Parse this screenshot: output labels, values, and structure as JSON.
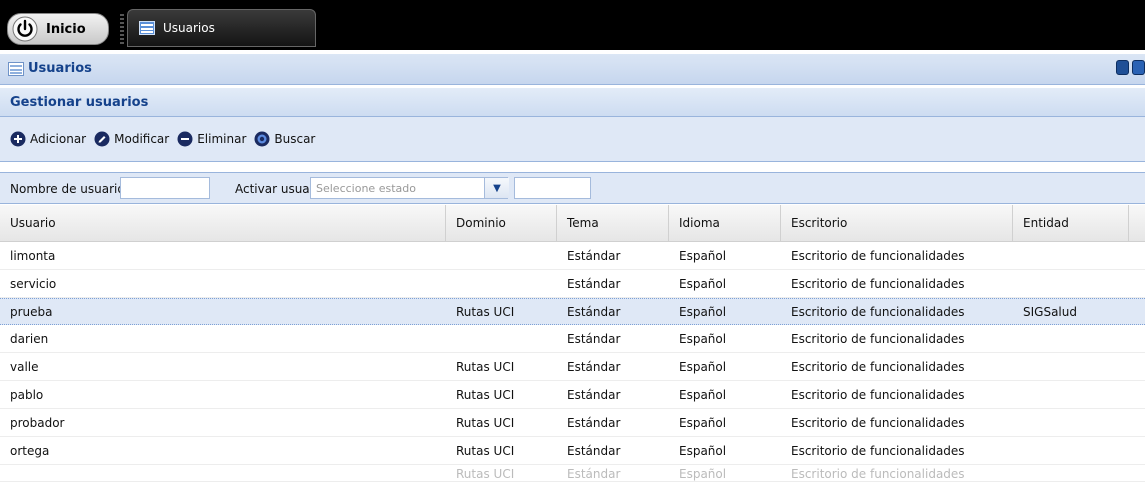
{
  "taskbar": {
    "start_label": "Inicio",
    "window_tab_label": "Usuarios"
  },
  "window": {
    "title": "Usuarios"
  },
  "panel": {
    "title": "Gestionar usuarios"
  },
  "toolbar": {
    "add_label": "Adicionar",
    "edit_label": "Modificar",
    "delete_label": "Eliminar",
    "search_label": "Buscar"
  },
  "filter": {
    "username_label": "Nombre de usuario",
    "username_value": "",
    "activate_label": "Activar usuario",
    "status_placeholder": "Seleccione estado",
    "extra_value": ""
  },
  "grid": {
    "columns": [
      "Usuario",
      "Dominio",
      "Tema",
      "Idioma",
      "Escritorio",
      "Entidad"
    ],
    "rows": [
      [
        "limonta",
        "",
        "Estándar",
        "Español",
        "Escritorio de funcionalidades",
        ""
      ],
      [
        "servicio",
        "",
        "Estándar",
        "Español",
        "Escritorio de funcionalidades",
        ""
      ],
      [
        "prueba",
        "Rutas UCI",
        "Estándar",
        "Español",
        "Escritorio de funcionalidades",
        "SIGSalud"
      ],
      [
        "darien",
        "",
        "Estándar",
        "Español",
        "Escritorio de funcionalidades",
        ""
      ],
      [
        "valle",
        "Rutas UCI",
        "Estándar",
        "Español",
        "Escritorio de funcionalidades",
        ""
      ],
      [
        "pablo",
        "Rutas UCI",
        "Estándar",
        "Español",
        "Escritorio de funcionalidades",
        ""
      ],
      [
        "probador",
        "Rutas UCI",
        "Estándar",
        "Español",
        "Escritorio de funcionalidades",
        ""
      ],
      [
        "ortega",
        "Rutas UCI",
        "Estándar",
        "Español",
        "Escritorio de funcionalidades",
        ""
      ],
      [
        "",
        "Rutas UCI",
        "Estándar",
        "Español",
        "Escritorio de funcionalidades",
        ""
      ]
    ]
  },
  "colors": {
    "header_text": "#15428b",
    "panel_bg": "#dfe8f6",
    "selected_row": "#dfe8f6"
  }
}
